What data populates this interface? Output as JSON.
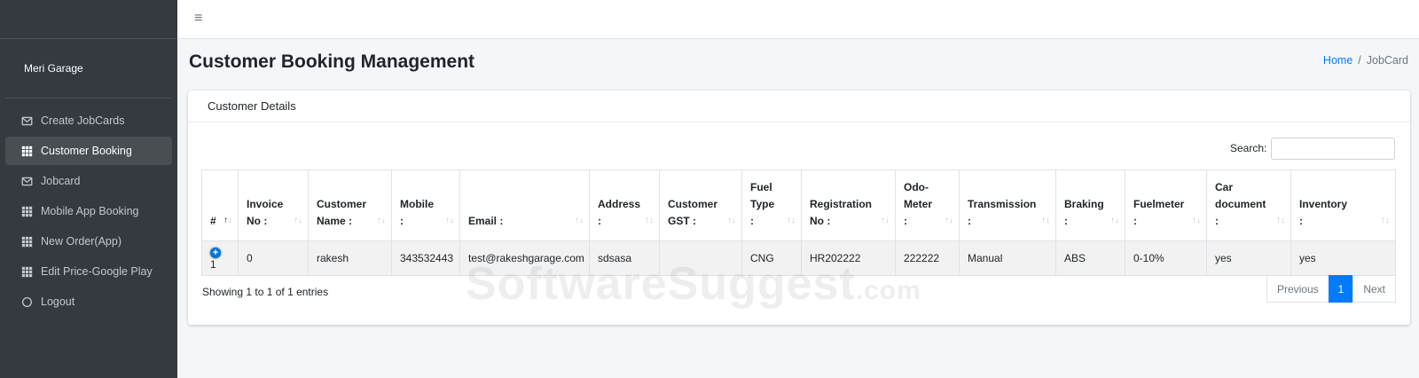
{
  "sidebar": {
    "brand": "Meri Garage",
    "items": [
      {
        "label": "Create JobCards",
        "icon": "envelope-icon"
      },
      {
        "label": "Customer Booking",
        "icon": "grid-icon",
        "active": true
      },
      {
        "label": "Jobcard",
        "icon": "envelope-icon"
      },
      {
        "label": "Mobile App Booking",
        "icon": "grid-icon"
      },
      {
        "label": "New Order(App)",
        "icon": "grid-icon"
      },
      {
        "label": "Edit Price-Google Play",
        "icon": "grid-icon"
      },
      {
        "label": "Logout",
        "icon": "circle-icon"
      }
    ]
  },
  "topbar": {
    "menu_icon": "≡"
  },
  "page": {
    "title": "Customer Booking Management",
    "breadcrumb": {
      "home": "Home",
      "separator": "/",
      "current": "JobCard"
    }
  },
  "card": {
    "header": "Customer Details",
    "search_label": "Search:",
    "search_value": ""
  },
  "table": {
    "headers": [
      {
        "line1": "#",
        "line2": ""
      },
      {
        "line1": "Invoice",
        "line2": "No :"
      },
      {
        "line1": "Customer",
        "line2": "Name :"
      },
      {
        "line1": "Mobile",
        "line2": ":"
      },
      {
        "line1": "",
        "line2": "Email :"
      },
      {
        "line1": "Address",
        "line2": ":"
      },
      {
        "line1": "Customer",
        "line2": "GST :"
      },
      {
        "line1": "Fuel",
        "line2": "Type",
        "line3": ":"
      },
      {
        "line1": "Registration",
        "line2": "No :"
      },
      {
        "line1": "Odo-",
        "line2": "Meter",
        "line3": ":"
      },
      {
        "line1": "Transmission",
        "line2": ":"
      },
      {
        "line1": "Braking",
        "line2": ":"
      },
      {
        "line1": "Fuelmeter",
        "line2": ":"
      },
      {
        "line1": "Car",
        "line2": "document",
        "line3": ":"
      },
      {
        "line1": "Inventory",
        "line2": ":"
      }
    ],
    "rows": [
      [
        "1",
        "0",
        "rakesh",
        "343532443",
        "test@rakeshgarage.com",
        "sdsasa",
        "",
        "CNG",
        "HR202222",
        "222222",
        "Manual",
        "ABS",
        "0-10%",
        "yes",
        "yes"
      ]
    ]
  },
  "footer": {
    "info": "Showing 1 to 1 of 1 entries",
    "previous": "Previous",
    "page": "1",
    "next": "Next"
  },
  "watermark": {
    "main": "SoftwareSuggest",
    "suffix": ".com"
  }
}
